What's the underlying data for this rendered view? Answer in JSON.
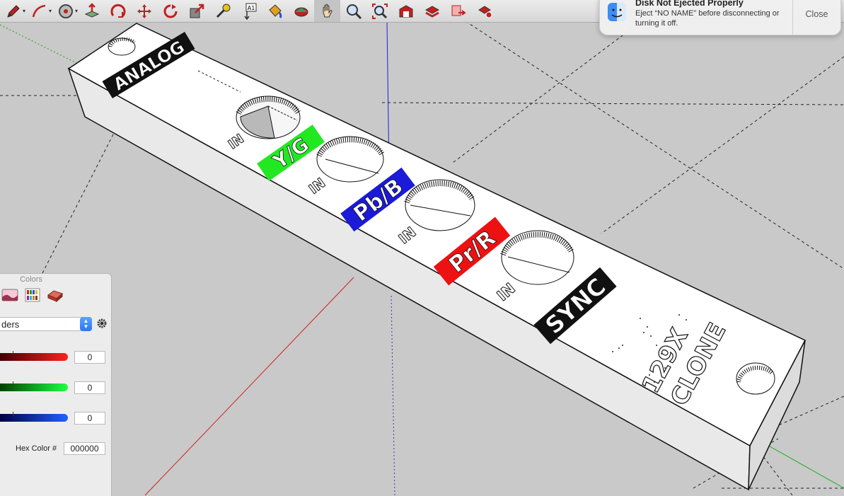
{
  "toolbar": {
    "tools": [
      {
        "name": "pencil-icon"
      },
      {
        "name": "arc-icon"
      },
      {
        "name": "offset-icon"
      },
      {
        "name": "push-pull-icon"
      },
      {
        "name": "rotate-icon"
      },
      {
        "name": "move-icon"
      },
      {
        "name": "follow-me-icon"
      },
      {
        "name": "scale-icon"
      },
      {
        "name": "tape-measure-icon"
      },
      {
        "name": "text-icon",
        "label": "A1"
      },
      {
        "name": "paint-bucket-icon"
      },
      {
        "name": "orbit-icon"
      },
      {
        "name": "pan-icon"
      },
      {
        "name": "zoom-icon"
      },
      {
        "name": "zoom-extents-icon"
      },
      {
        "name": "warehouse-icon"
      },
      {
        "name": "extension-warehouse-icon"
      },
      {
        "name": "share-model-icon"
      },
      {
        "name": "extension-manager-icon"
      }
    ]
  },
  "notification": {
    "title": "Disk Not Ejected Properly",
    "body": "Eject “NO NAME” before disconnecting or turning it off.",
    "close_label": "Close"
  },
  "model": {
    "labels": {
      "analog": "ANALOG",
      "yg": "Y/G",
      "pbb": "Pb/B",
      "prr": "Pr/R",
      "sync": "SYNC",
      "in": "IN",
      "title_1": "129X",
      "title_2": "CLONE"
    },
    "colors": {
      "yg": "#22e822",
      "pbb": "#1a1ad8",
      "prr": "#ee1111",
      "sync": "#111111"
    }
  },
  "colors_panel": {
    "title": "Colors",
    "mode": "ders",
    "red": "0",
    "green": "0",
    "blue": "0",
    "hex_label": "Hex Color #",
    "hex_value": "000000"
  }
}
